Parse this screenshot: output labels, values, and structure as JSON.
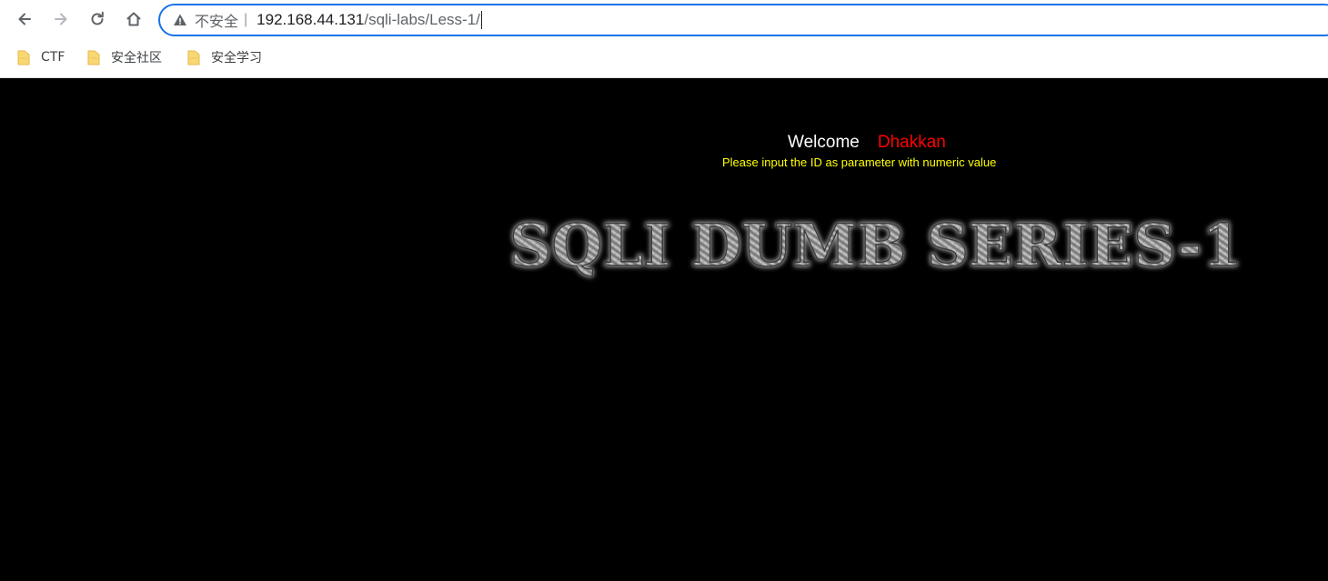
{
  "browser": {
    "not_secure_label": "不安全",
    "separator": "|",
    "url_host": "192.168.44.131",
    "url_path": "/sqli-labs/Less-1/",
    "bookmarks": [
      {
        "label": "CTF"
      },
      {
        "label": "安全社区"
      },
      {
        "label": "安全学习"
      }
    ]
  },
  "page": {
    "welcome": "Welcome",
    "username": "Dhakkan",
    "instruction": "Please input the ID as parameter with numeric value",
    "title_image_text": "SQLI DUMB SERIES-1"
  },
  "colors": {
    "background": "#000000",
    "welcome": "#ffffff",
    "username": "#ff0000",
    "instruction": "#ffff00",
    "omnibox_border": "#1a73e8"
  },
  "icons": {
    "back": "arrow-left-icon",
    "forward": "arrow-right-icon",
    "reload": "reload-icon",
    "home": "home-icon",
    "warning": "warning-triangle-icon",
    "bookmark_folder": "folder-icon"
  }
}
